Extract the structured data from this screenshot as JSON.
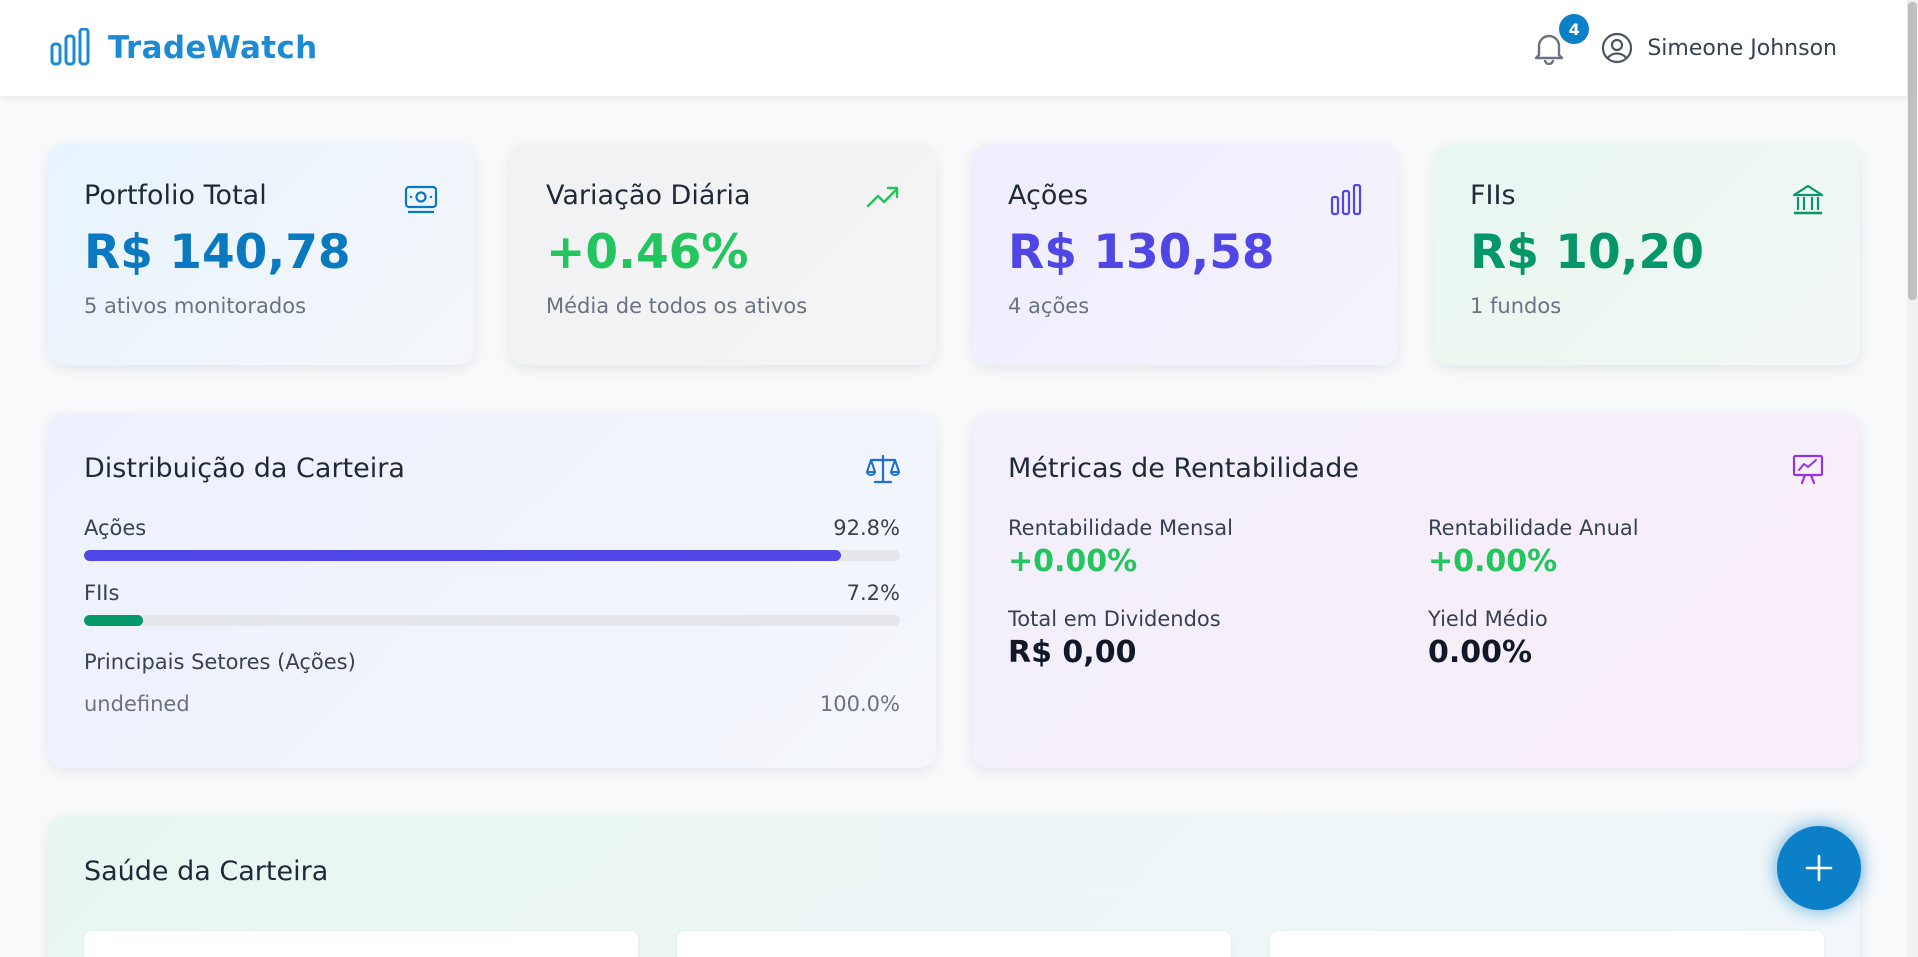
{
  "brand": {
    "name": "TradeWatch"
  },
  "header": {
    "notification_count": "4",
    "user_name": "Simeone Johnson"
  },
  "stats": [
    {
      "title": "Portfolio Total",
      "value": "R$ 140,78",
      "subtitle": "5 ativos monitorados",
      "icon": "cash-icon"
    },
    {
      "title": "Variação Diária",
      "value": "+0.46%",
      "subtitle": "Média de todos os ativos",
      "icon": "trending-up-icon"
    },
    {
      "title": "Ações",
      "value": "R$ 130,58",
      "subtitle": "4 ações",
      "icon": "bar-chart-icon"
    },
    {
      "title": "FIIs",
      "value": "R$ 10,20",
      "subtitle": "1 fundos",
      "icon": "bank-icon"
    }
  ],
  "distribution": {
    "title": "Distribuição da Carteira",
    "bars": [
      {
        "label": "Ações",
        "percent_label": "92.8%",
        "percent": 92.8,
        "color": "#4f46e5"
      },
      {
        "label": "FIIs",
        "percent_label": "7.2%",
        "percent": 7.2,
        "color": "#059669"
      }
    ],
    "sectors_title": "Principais Setores (Ações)",
    "sectors": [
      {
        "name": "undefined",
        "percent": "100.0%"
      }
    ]
  },
  "metrics": {
    "title": "Métricas de Rentabilidade",
    "items": [
      {
        "label": "Rentabilidade Mensal",
        "value": "+0.00%"
      },
      {
        "label": "Rentabilidade Anual",
        "value": "+0.00%"
      },
      {
        "label": "Total em Dividendos",
        "value": "R$ 0,00"
      },
      {
        "label": "Yield Médio",
        "value": "0.00%"
      }
    ]
  },
  "health": {
    "title": "Saúde da Carteira"
  },
  "colors": {
    "brand": "#1c8bd3",
    "accent_blue": "#0b79c0",
    "positive": "#22c55e",
    "stocks": "#4f46e5",
    "funds": "#059669"
  }
}
